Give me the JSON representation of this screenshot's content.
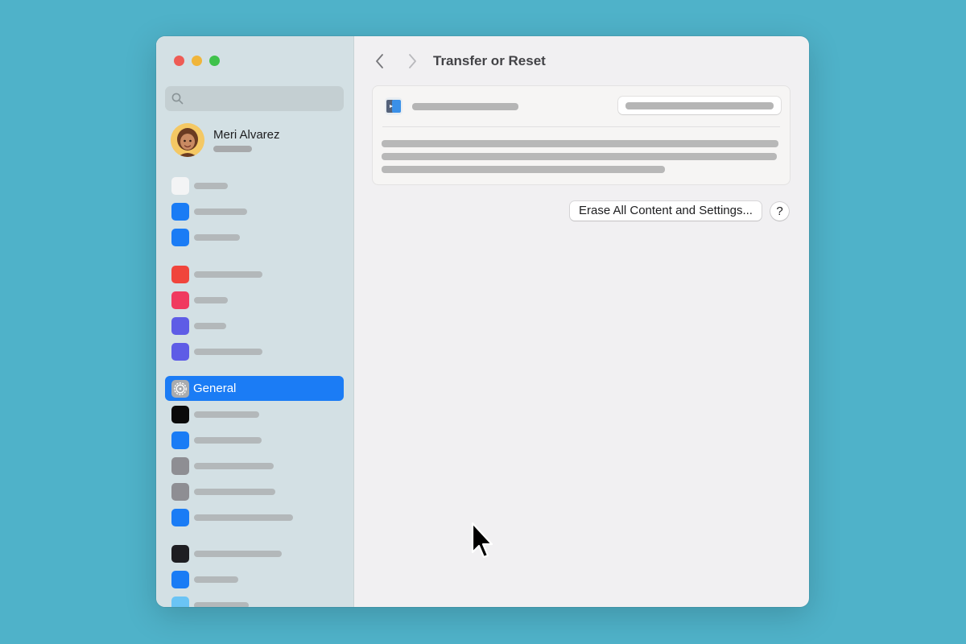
{
  "window": {
    "traffic_lights": [
      "close",
      "minimize",
      "zoom"
    ]
  },
  "sidebar": {
    "search": {
      "placeholder": "",
      "icon": "search-icon"
    },
    "user": {
      "name": "Meri Alvarez",
      "avatar": "memoji-avatar"
    },
    "items": [
      {
        "key": "item-1",
        "icon_color": "#f3f4f5"
      },
      {
        "key": "item-2",
        "icon_color": "#1a7cf5"
      },
      {
        "key": "item-3",
        "icon_color": "#1a7cf5"
      },
      {
        "key": "item-4",
        "icon_color": "#f0453c"
      },
      {
        "key": "item-5",
        "icon_color": "#f03a5f"
      },
      {
        "key": "item-6",
        "icon_color": "#5e5ce6"
      },
      {
        "key": "item-7",
        "icon_color": "#5e5ce6"
      },
      {
        "key": "general",
        "label": "General",
        "icon": "gear-icon",
        "selected": true
      },
      {
        "key": "item-9",
        "icon_color": "#0a0a0a"
      },
      {
        "key": "item-10",
        "icon_color": "#1a7cf5"
      },
      {
        "key": "item-11",
        "icon_color": "#8e8e93"
      },
      {
        "key": "item-12",
        "icon_color": "#8e8e93"
      },
      {
        "key": "item-13",
        "icon_color": "#1a7cf5"
      },
      {
        "key": "item-14",
        "icon_color": "#1e1e22"
      },
      {
        "key": "item-15",
        "icon_color": "#1a7cf5"
      },
      {
        "key": "item-16",
        "icon_color": "#6ac4f5"
      }
    ]
  },
  "main": {
    "nav": {
      "back_icon": "chevron-left-icon",
      "forward_icon": "chevron-right-icon"
    },
    "title": "Transfer or Reset",
    "erase_button_label": "Erase All Content and Settings...",
    "help_label": "?"
  },
  "colors": {
    "desktop": "#4fb2c9",
    "accent": "#1b7cf5",
    "sidebar": "#d3e0e4"
  }
}
